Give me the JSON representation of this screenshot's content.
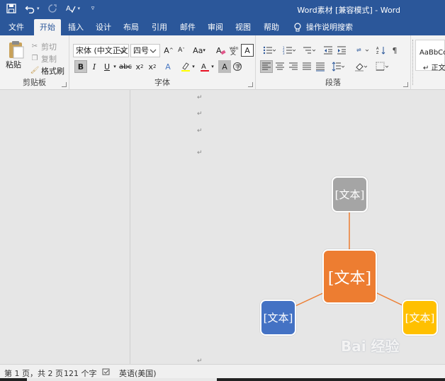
{
  "window": {
    "title": "Word素材 [兼容模式] - Word"
  },
  "qat": {
    "save": "save-icon",
    "undo": "undo-icon",
    "redo": "redo-icon",
    "spelling": "spelling-icon",
    "customize": "customize-qat-icon"
  },
  "tabs": [
    "文件",
    "开始",
    "插入",
    "设计",
    "布局",
    "引用",
    "邮件",
    "审阅",
    "视图",
    "帮助"
  ],
  "active_tab": "开始",
  "tell_me": "操作说明搜索",
  "clipboard": {
    "paste": "粘贴",
    "cut": "剪切",
    "copy": "复制",
    "format_painter": "格式刷",
    "label": "剪贴板"
  },
  "font": {
    "font_name": "宋体 (中文正文",
    "font_size": "四号",
    "change_case": "Aa",
    "bold": "B",
    "italic": "I",
    "underline": "U",
    "strikethrough": "abc",
    "subscript": "x",
    "superscript": "x",
    "label": "字体"
  },
  "paragraph": {
    "label": "段落"
  },
  "styles": {
    "sample": "AaBbCcDd",
    "name": "正文"
  },
  "diagram": {
    "top_node": "[文本]",
    "center_node": "[文本]",
    "left_node": "[文本]",
    "right_node": "[文本]",
    "colors": {
      "top": "#a5a5a5",
      "center": "#ed7d31",
      "left": "#4472c4",
      "right": "#ffc000",
      "connector": "#ed7d31"
    }
  },
  "watermark": {
    "text": "Bai 经验"
  },
  "status": {
    "page": "第 1 页，共 2 页",
    "words": "121 个字",
    "language": "英语(美国)"
  },
  "theme": {
    "accent": "#2b579a"
  }
}
